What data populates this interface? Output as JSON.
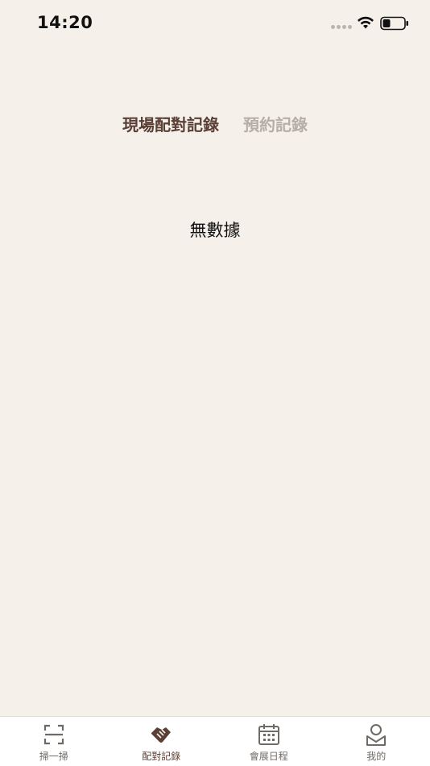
{
  "status_bar": {
    "time": "14:20"
  },
  "tabs": [
    {
      "label": "現場配對記錄",
      "active": true
    },
    {
      "label": "預約記錄",
      "active": false
    }
  ],
  "empty_state": {
    "text": "無數據"
  },
  "tabbar": {
    "items": [
      {
        "label": "掃一掃",
        "icon": "scan-icon",
        "active": false
      },
      {
        "label": "配對記錄",
        "icon": "handshake-icon",
        "active": true
      },
      {
        "label": "會展日程",
        "icon": "calendar-icon",
        "active": false
      },
      {
        "label": "我的",
        "icon": "profile-icon",
        "active": false
      }
    ]
  },
  "colors": {
    "background": "#f5f1ea",
    "accent": "#5a3f36",
    "inactive_tab": "#b4aea6",
    "tabbar_background": "#ffffff"
  }
}
